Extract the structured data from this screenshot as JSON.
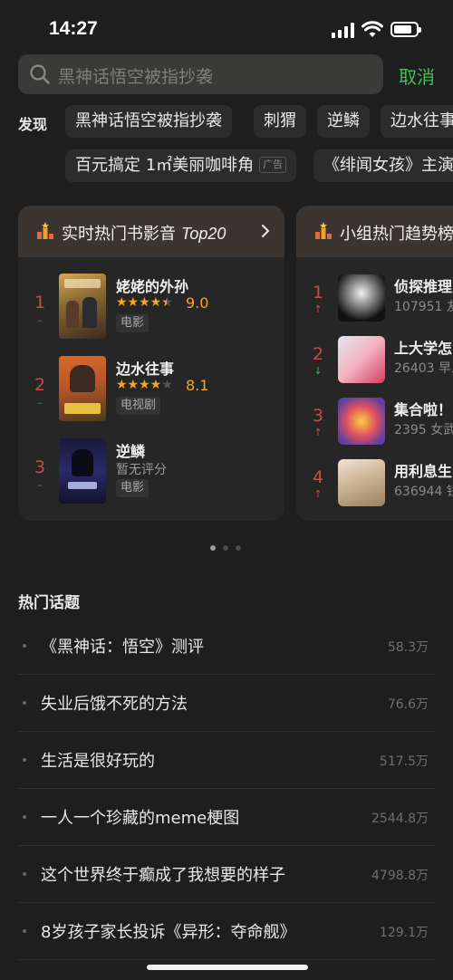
{
  "status_bar": {
    "time": "14:27"
  },
  "search": {
    "query": "黑神话悟空被指抄袭",
    "cancel_label": "取消"
  },
  "discover": {
    "label": "发现",
    "row1": [
      "黑神话悟空被指抄袭",
      "刺猬",
      "逆鳞",
      "边水往事"
    ],
    "row2": {
      "ad_text": "百元搞定 1㎡美丽咖啡角",
      "ad_tag": "广告",
      "chip2": "《绯闻女孩》主演"
    }
  },
  "movie_card": {
    "title": "实时热门书影音",
    "title_em": "Top20",
    "items": [
      {
        "rank": "1",
        "trend": "–",
        "title": "姥姥的外孙",
        "stars": "★★★★★",
        "score": "9.0",
        "type": "电影",
        "rating_stars": 4.5
      },
      {
        "rank": "2",
        "trend": "–",
        "title": "边水往事",
        "stars": "★★★★★",
        "score": "8.1",
        "type": "电视剧",
        "rating_stars": 4
      },
      {
        "rank": "3",
        "trend": "–",
        "title": "逆鳞",
        "noscore": "暂无评分",
        "type": "电影"
      }
    ]
  },
  "group_card": {
    "title": "小组热门趋势榜",
    "items": [
      {
        "rank": "1",
        "trend": "↑",
        "title": "侦探推理",
        "sub": "107951 友"
      },
      {
        "rank": "2",
        "trend": "↓",
        "title": "上大学怎",
        "sub": "26403 早八"
      },
      {
        "rank": "3",
        "trend": "↑",
        "title": "集合啦！",
        "sub": "2395 女武"
      },
      {
        "rank": "4",
        "trend": "↑",
        "title": "用利息生",
        "sub": "636944 钱"
      }
    ]
  },
  "topics": {
    "title": "热门话题",
    "items": [
      {
        "title": "《黑神话：悟空》测评",
        "count": "58.3万"
      },
      {
        "title": "失业后饿不死的方法",
        "count": "76.6万"
      },
      {
        "title": "生活是很好玩的",
        "count": "517.5万"
      },
      {
        "title": "一人一个珍藏的meme梗图",
        "count": "2544.8万"
      },
      {
        "title": "这个世界终于癫成了我想要的样子",
        "count": "4798.8万"
      },
      {
        "title": "8岁孩子家长投诉《异形：夺命舰》",
        "count": "129.1万"
      }
    ]
  },
  "colors": {
    "accent_green": "#42bd56",
    "rank_red": "#c94a4a",
    "star_orange": "#f5a623"
  }
}
